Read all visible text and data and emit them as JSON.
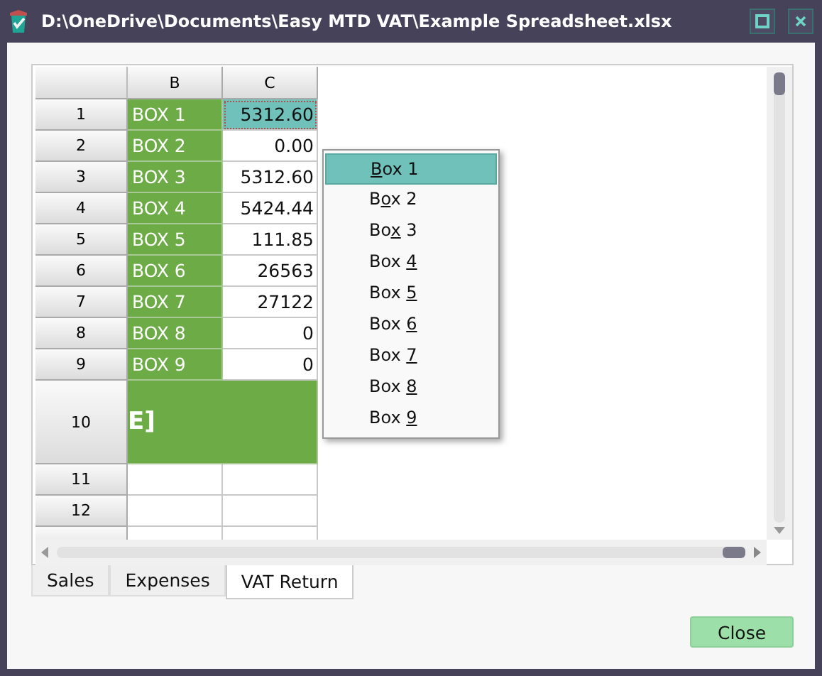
{
  "window": {
    "title": "D:\\OneDrive\\Documents\\Easy MTD VAT\\Example Spreadsheet.xlsx"
  },
  "sheet": {
    "columns": [
      "B",
      "C"
    ],
    "rows": [
      {
        "kind": "value",
        "header": "1",
        "label": "BOX 1",
        "value": "5312.60",
        "selected": true
      },
      {
        "kind": "value",
        "header": "2",
        "label": "BOX 2",
        "value": "0.00",
        "selected": false
      },
      {
        "kind": "value",
        "header": "3",
        "label": "BOX 3",
        "value": "5312.60",
        "selected": false
      },
      {
        "kind": "value",
        "header": "4",
        "label": "BOX 4",
        "value": "5424.44",
        "selected": false
      },
      {
        "kind": "value",
        "header": "5",
        "label": "BOX 5",
        "value": "111.85",
        "selected": false
      },
      {
        "kind": "value",
        "header": "6",
        "label": "BOX 6",
        "value": "26563",
        "selected": false
      },
      {
        "kind": "value",
        "header": "7",
        "label": "BOX 7",
        "value": "27122",
        "selected": false
      },
      {
        "kind": "value",
        "header": "8",
        "label": "BOX 8",
        "value": "0",
        "selected": false
      },
      {
        "kind": "value",
        "header": "9",
        "label": "BOX 9",
        "value": "0",
        "selected": false
      },
      {
        "kind": "merged",
        "header": "10",
        "label": "E]"
      },
      {
        "kind": "empty",
        "header": "11"
      },
      {
        "kind": "empty",
        "header": "12"
      },
      {
        "kind": "cut"
      }
    ]
  },
  "menu": {
    "items": [
      {
        "key": "B",
        "after": "ox 1",
        "selected": true
      },
      {
        "before": "B",
        "key": "o",
        "after": "x 2",
        "selected": false
      },
      {
        "before": "Bo",
        "key": "x",
        "after": " 3",
        "selected": false
      },
      {
        "before": "Box ",
        "key": "4",
        "selected": false
      },
      {
        "before": "Box ",
        "key": "5",
        "selected": false
      },
      {
        "before": "Box ",
        "key": "6",
        "selected": false
      },
      {
        "before": "Box ",
        "key": "7",
        "selected": false
      },
      {
        "before": "Box ",
        "key": "8",
        "selected": false
      },
      {
        "before": "Box ",
        "key": "9",
        "selected": false
      }
    ]
  },
  "tabs": [
    {
      "label": "Sales",
      "selected": false
    },
    {
      "label": "Expenses",
      "selected": false
    },
    {
      "label": "VAT Return",
      "selected": true
    }
  ],
  "buttons": [
    {
      "label": "Close"
    }
  ]
}
